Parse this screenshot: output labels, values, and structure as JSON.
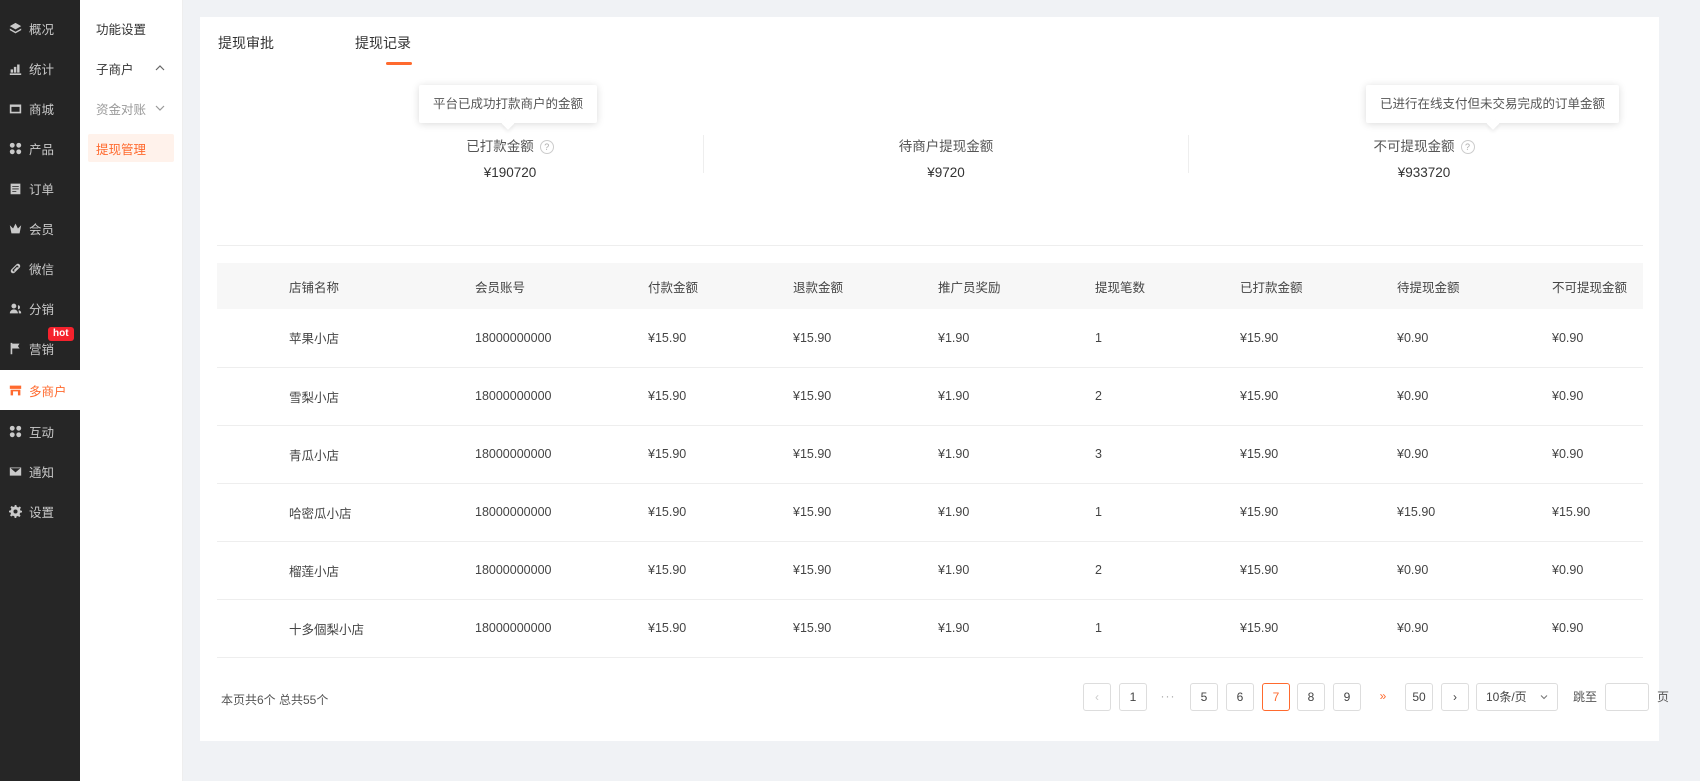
{
  "sidebar": {
    "items": [
      {
        "label": "概况",
        "icon": "layers-icon"
      },
      {
        "label": "统计",
        "icon": "chart-icon"
      },
      {
        "label": "商城",
        "icon": "store-icon"
      },
      {
        "label": "产品",
        "icon": "grid-icon"
      },
      {
        "label": "订单",
        "icon": "clipboard-icon"
      },
      {
        "label": "会员",
        "icon": "crown-icon"
      },
      {
        "label": "微信",
        "icon": "link-icon"
      },
      {
        "label": "分销",
        "icon": "users-icon"
      },
      {
        "label": "营销",
        "icon": "flag-icon"
      },
      {
        "label": "多商户",
        "icon": "shop-icon"
      },
      {
        "label": "互动",
        "icon": "grid-icon"
      },
      {
        "label": "通知",
        "icon": "mail-icon"
      },
      {
        "label": "设置",
        "icon": "gear-icon"
      }
    ],
    "hot_badge": "hot",
    "active": "多商户"
  },
  "subnav": {
    "items": [
      {
        "label": "功能设置"
      },
      {
        "label": "子商户"
      },
      {
        "label": "资金对账"
      },
      {
        "label": "提现管理"
      }
    ],
    "active": "提现管理"
  },
  "tabs": [
    {
      "label": "提现审批"
    },
    {
      "label": "提现记录"
    }
  ],
  "active_tab": "提现记录",
  "stats": [
    {
      "label": "已打款金额",
      "value": "¥190720",
      "tooltip": "平台已成功打款商户的金额"
    },
    {
      "label": "待商户提现金额",
      "value": "¥9720"
    },
    {
      "label": "不可提现金额",
      "value": "¥933720",
      "tooltip": "已进行在线支付但未交易完成的订单金额"
    }
  ],
  "help_icon": "?",
  "table": {
    "headers": [
      "店铺名称",
      "会员账号",
      "付款金额",
      "退款金额",
      "推广员奖励",
      "提现笔数",
      "已打款金额",
      "待提现金额",
      "不可提现金额"
    ],
    "rows": [
      [
        "苹果小店",
        "18000000000",
        "¥15.90",
        "¥15.90",
        "¥1.90",
        "1",
        "¥15.90",
        "¥0.90",
        "¥0.90"
      ],
      [
        "雪梨小店",
        "18000000000",
        "¥15.90",
        "¥15.90",
        "¥1.90",
        "2",
        "¥15.90",
        "¥0.90",
        "¥0.90"
      ],
      [
        "青瓜小店",
        "18000000000",
        "¥15.90",
        "¥15.90",
        "¥1.90",
        "3",
        "¥15.90",
        "¥0.90",
        "¥0.90"
      ],
      [
        "哈密瓜小店",
        "18000000000",
        "¥15.90",
        "¥15.90",
        "¥1.90",
        "1",
        "¥15.90",
        "¥15.90",
        "¥15.90"
      ],
      [
        "榴莲小店",
        "18000000000",
        "¥15.90",
        "¥15.90",
        "¥1.90",
        "2",
        "¥15.90",
        "¥0.90",
        "¥0.90"
      ],
      [
        "十多個梨小店",
        "18000000000",
        "¥15.90",
        "¥15.90",
        "¥1.90",
        "1",
        "¥15.90",
        "¥0.90",
        "¥0.90"
      ]
    ]
  },
  "footer": {
    "summary": "本页共6个  总共55个"
  },
  "pagination": {
    "prev": "‹",
    "next": "›",
    "pages": [
      "1",
      "···",
      "5",
      "6",
      "7",
      "8",
      "9",
      "»",
      "50"
    ],
    "current": "7",
    "page_size": "10条/页",
    "goto_label": "跳至",
    "goto_suffix": "页"
  },
  "colors": {
    "accent": "#ff6a2e",
    "sidebar_bg": "#252525",
    "badge": "#f5222d"
  }
}
